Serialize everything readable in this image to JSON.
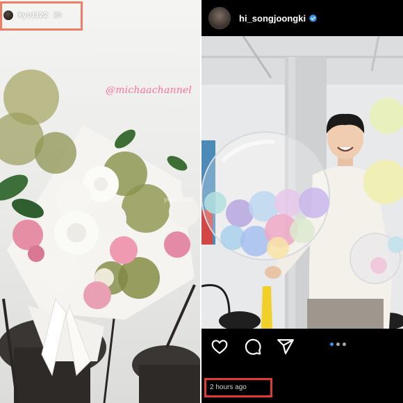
{
  "story": {
    "username": "kyo1122",
    "time_ago": "2h",
    "mention": "@michaachannel",
    "watermark": "yeoce1425"
  },
  "post": {
    "username": "hi_songjoongki",
    "timestamp": "2 hours ago",
    "verified": true,
    "carousel_total": 3,
    "carousel_active": 1
  },
  "icons": {
    "like": "heart-icon",
    "comment": "comment-icon",
    "share": "send-icon",
    "verified": "verified-badge-icon"
  },
  "colors": {
    "highlight_left": "#ef7d63",
    "highlight_right": "#e03b34",
    "mention": "#ff6f9e",
    "verified": "#3897f0"
  }
}
